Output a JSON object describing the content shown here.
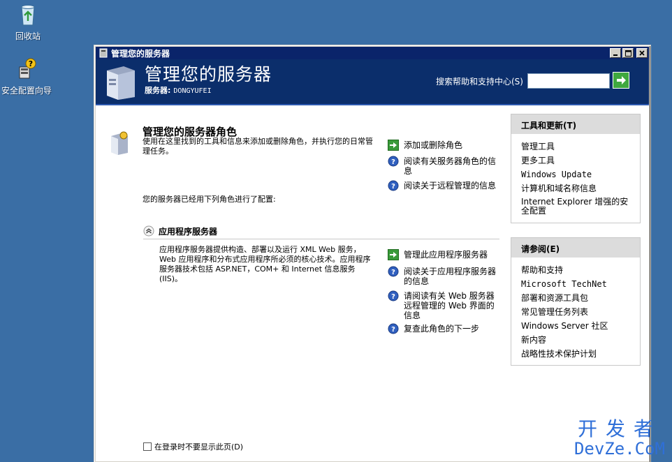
{
  "desktop": {
    "recycle_label": "回收站",
    "wizard_label": "安全配置向导"
  },
  "window": {
    "title": "管理您的服务器"
  },
  "header": {
    "title": "管理您的服务器",
    "server_label": "服务器:",
    "server_name": "DONGYUFEI",
    "search_label": "搜索帮助和支持中心(S)",
    "search_value": ""
  },
  "main": {
    "heading": "管理您的服务器角色",
    "description": "使用在这里找到的工具和信息来添加或删除角色，并执行您的日常管理任务。",
    "links": [
      "添加或删除角色",
      "阅读有关服务器角色的信息",
      "阅读关于远程管理的信息"
    ],
    "configured_text": "您的服务器已经用下列角色进行了配置:",
    "role": {
      "title": "应用程序服务器",
      "description": "应用程序服务器提供构造、部署以及运行 XML Web 服务，Web 应用程序和分布式应用程序所必须的核心技术。应用程序服务器技术包括 ASP.NET，COM+ 和 Internet 信息服务(IIS)。",
      "links": [
        "管理此应用程序服务器",
        "阅读关于应用程序服务器的信息",
        "请阅读有关 Web 服务器远程管理的 Web 界面的信息",
        "复查此角色的下一步"
      ]
    },
    "checkbox_label": "在登录时不要显示此页(D)"
  },
  "sidebar": {
    "tools": {
      "heading": "工具和更新(T)",
      "items": [
        "管理工具",
        "更多工具",
        "Windows Update",
        "计算机和域名称信息",
        "Internet Explorer 增强的安全配置"
      ]
    },
    "see_also": {
      "heading": "请参阅(E)",
      "items": [
        "帮助和支持",
        "Microsoft TechNet",
        "部署和资源工具包",
        "常见管理任务列表",
        "Windows Server 社区",
        "新内容",
        "战略性技术保护计划"
      ]
    }
  },
  "watermark": {
    "line1": "开发者",
    "line2": "DevZe.CoM"
  },
  "colors": {
    "desktop": "#3a6ea5",
    "titlebar": "#0a246a",
    "header": "#0b2e6b",
    "go_button": "#3fa83f",
    "help_icon": "#2f5fbf"
  }
}
